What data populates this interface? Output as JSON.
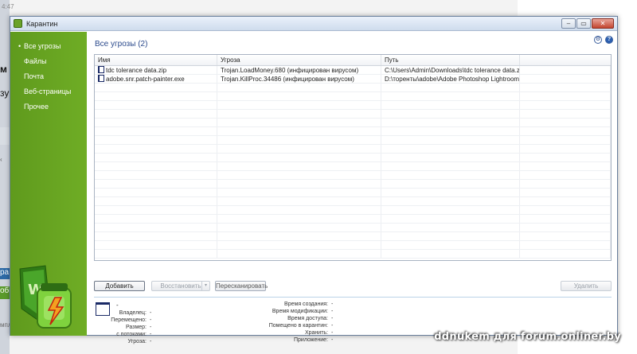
{
  "background": {
    "frag_top": "4:47",
    "frag_mid1": "м не",
    "frag_mid2": "зу",
    "frag_arrow": "‹",
    "frag_low1": "ра",
    "frag_low2": "обш",
    "frag_low3": "мпл"
  },
  "window": {
    "title": "Карантин",
    "buttons": {
      "minimize": "–",
      "maximize": "▭",
      "close": "✕"
    }
  },
  "sidebar": {
    "items": [
      {
        "label": "Все угрозы",
        "active": true
      },
      {
        "label": "Файлы",
        "active": false
      },
      {
        "label": "Почта",
        "active": false
      },
      {
        "label": "Веб-страницы",
        "active": false
      },
      {
        "label": "Прочее",
        "active": false
      }
    ],
    "active_bullet": "•"
  },
  "main": {
    "heading": "Все угрозы (2)",
    "settings_icon": "gear-icon",
    "help_icon": "help-icon",
    "help_glyph": "?",
    "settings_glyph": "⚙"
  },
  "table": {
    "columns": [
      "Имя",
      "Угроза",
      "Путь",
      ""
    ],
    "rows": [
      {
        "name": "tdc tolerance data.zip",
        "threat": "Trojan.LoadMoney.680 (инфицирован вирусом)",
        "path": "C:\\Users\\Admin\\Downloads\\tdc tolerance data.zip"
      },
      {
        "name": "adobe.snr.patch-painter.exe",
        "threat": "Trojan.KillProc.34486 (инфицирован вирусом)",
        "path": "D:\\торенты\\adobe\\Adobe Photoshop Lightroom ..."
      }
    ]
  },
  "buttons": {
    "add": "Добавить",
    "restore": "Восстановить",
    "restore_caret": "▾",
    "rescan": "Пересканировать",
    "delete": "Удалить"
  },
  "details": {
    "title": "-",
    "left": [
      {
        "key": "Владелец:",
        "value": "-"
      },
      {
        "key": "Перемещено:",
        "value": "-"
      },
      {
        "key": "Размер:",
        "value": "-"
      },
      {
        "key": "с потоками:",
        "value": "-"
      },
      {
        "key": "Угроза:",
        "value": "-"
      }
    ],
    "right": [
      {
        "key": "Время создания:",
        "value": "-"
      },
      {
        "key": "Время модификации:",
        "value": "-"
      },
      {
        "key": "Время доступа:",
        "value": "-"
      },
      {
        "key": "Помещено в карантин:",
        "value": "-"
      },
      {
        "key": "Хранить:",
        "value": "-"
      },
      {
        "key": "Приложение:",
        "value": "-"
      }
    ]
  },
  "watermark": "ddnukem для forum.onliner.by",
  "colors": {
    "sidebar_green": "#6aa229",
    "heading_blue": "#2b4a8c",
    "close_red": "#c3452f"
  }
}
